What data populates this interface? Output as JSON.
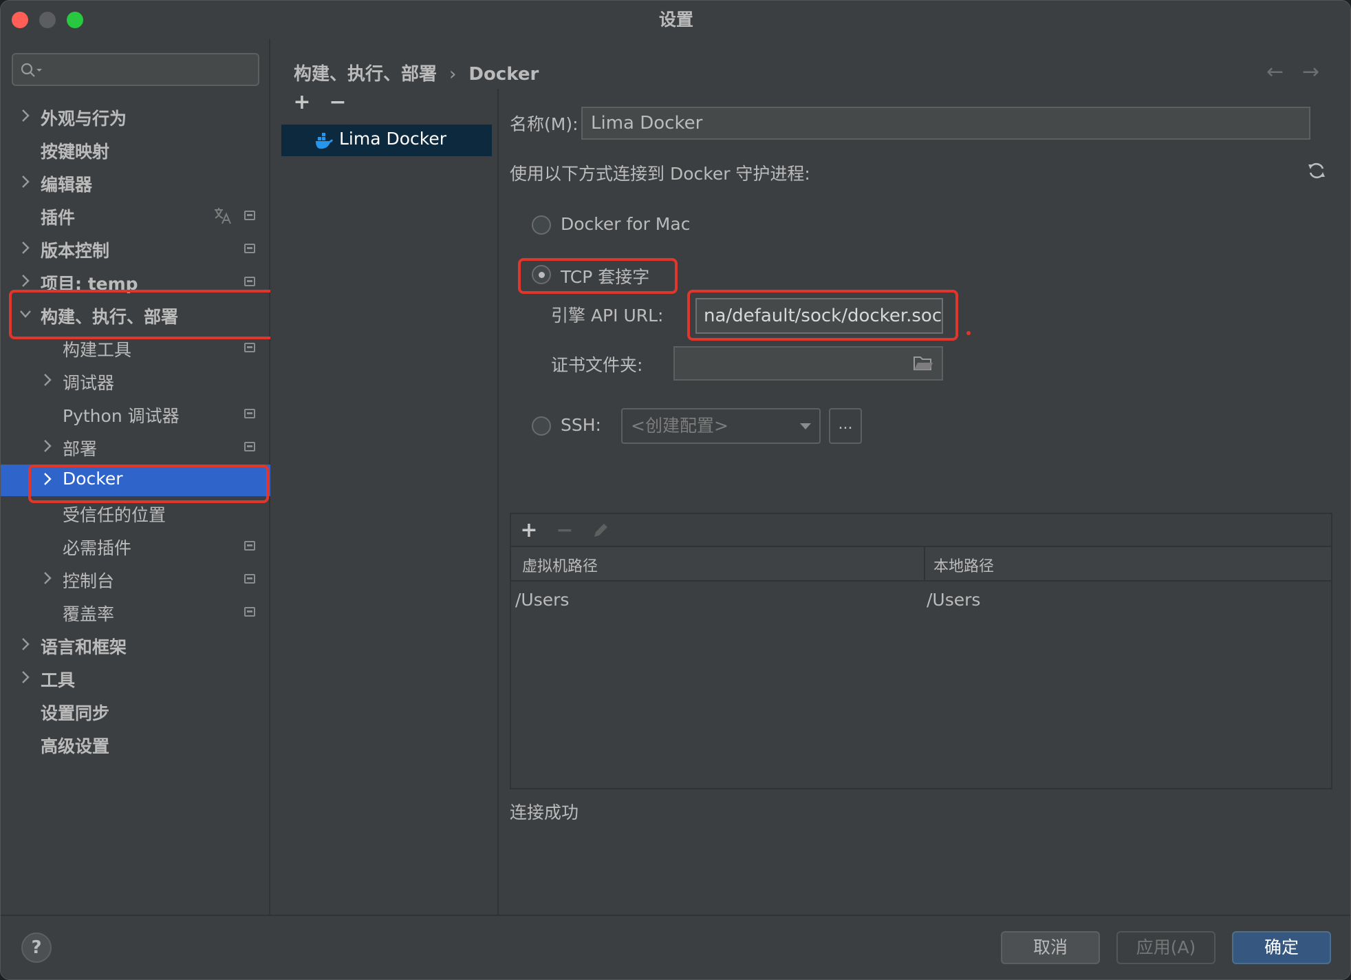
{
  "window": {
    "title": "设置"
  },
  "sidebar": {
    "search_placeholder": "",
    "items": [
      {
        "label": "外观与行为"
      },
      {
        "label": "按键映射"
      },
      {
        "label": "编辑器"
      },
      {
        "label": "插件"
      },
      {
        "label": "版本控制"
      },
      {
        "label": "项目: temp"
      },
      {
        "label": "构建、执行、部署"
      },
      {
        "label": "构建工具"
      },
      {
        "label": "调试器"
      },
      {
        "label": "Python 调试器"
      },
      {
        "label": "部署"
      },
      {
        "label": "Docker"
      },
      {
        "label": "受信任的位置"
      },
      {
        "label": "必需插件"
      },
      {
        "label": "控制台"
      },
      {
        "label": "覆盖率"
      },
      {
        "label": "语言和框架"
      },
      {
        "label": "工具"
      },
      {
        "label": "设置同步"
      },
      {
        "label": "高级设置"
      }
    ]
  },
  "content": {
    "breadcrumb": {
      "parent": "构建、执行、部署",
      "separator": "›",
      "current": "Docker"
    },
    "nav": {
      "back": "←",
      "forward": "→"
    },
    "list": {
      "add": "+",
      "remove": "−",
      "items": [
        {
          "label": "Lima Docker"
        }
      ]
    },
    "form": {
      "name_label": "名称(M):",
      "name_value": "Lima Docker",
      "connect_label": "使用以下方式连接到 Docker 守护进程:",
      "options": {
        "docker_for_mac": "Docker for Mac",
        "tcp": "TCP 套接字",
        "ssh": "SSH:"
      },
      "api_url_label": "引擎 API URL:",
      "api_url_value": "na/default/sock/docker.sock",
      "cert_label": "证书文件夹:",
      "cert_value": "",
      "ssh_placeholder": "<创建配置>",
      "dots": "..."
    },
    "table": {
      "tools": {
        "add": "+",
        "remove": "−"
      },
      "headers": [
        "虚拟机路径",
        "本地路径"
      ],
      "rows": [
        [
          "/Users",
          "/Users"
        ]
      ]
    },
    "status": "连接成功"
  },
  "footer": {
    "help": "?",
    "cancel": "取消",
    "apply": "应用(A)",
    "ok": "确定"
  },
  "colors": {
    "selection": "#2f65ca",
    "highlight_box": "#e0362c",
    "primary_button": "#365880"
  }
}
